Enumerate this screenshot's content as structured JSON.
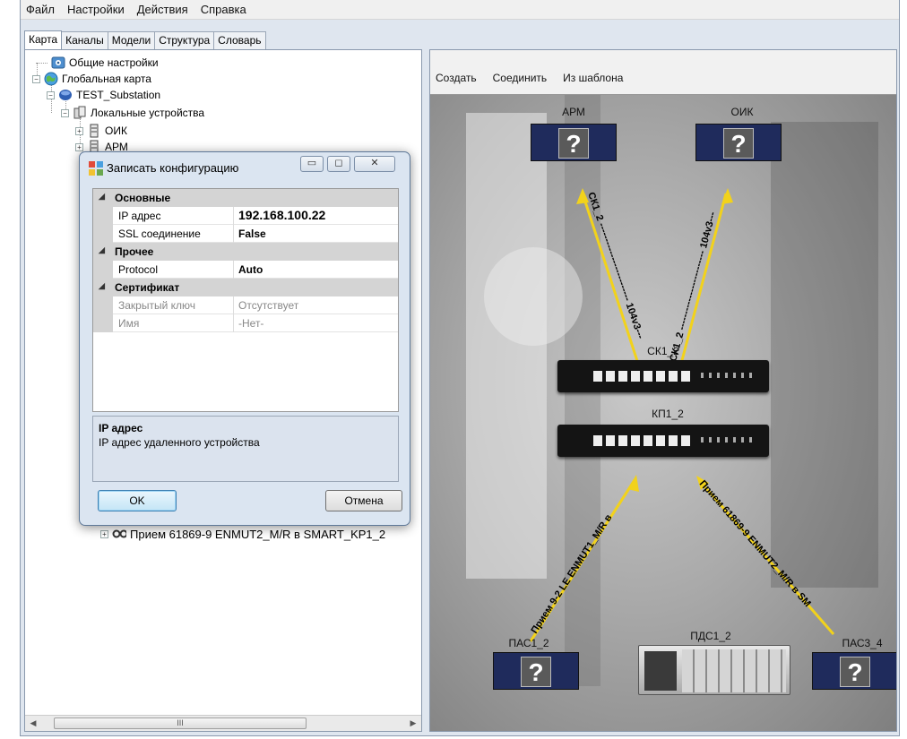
{
  "menu": [
    "Файл",
    "Настройки",
    "Действия",
    "Справка"
  ],
  "tabs": [
    "Карта",
    "Каналы",
    "Модели",
    "Структура",
    "Словарь"
  ],
  "tree": {
    "general": "Общие настройки",
    "global_map": "Глобальная карта",
    "substation": "TEST_Substation",
    "local_devices": "Локальные устройства",
    "oik": "ОИК",
    "arm": "АРМ",
    "bottom_item": "Прием 61869-9 ENMUT2_M/R в SMART_KP1_2"
  },
  "map_toolbar": {
    "create": "Создать",
    "connect": "Соединить",
    "from_template": "Из шаблона"
  },
  "map": {
    "nodes": {
      "arm": "АРМ",
      "oik": "ОИК",
      "sk1": "СК1_2",
      "kp1": "КП1_2",
      "pas1": "ПАС1_2",
      "pds1": "ПДС1_2",
      "pas3": "ПАС3_4"
    },
    "unknown_glyph": "?",
    "edges": {
      "e1": "СК1_2 ------------------------- 104v3---",
      "e2": "СК1_2 ------------------------- 104v3---",
      "e3": "Прием 9-2 LE ENMUT1_M/R в",
      "e4": "Прием 61869-9 ENMUT2_M/R в SM"
    },
    "edge_color": "#f2d21b"
  },
  "dialog": {
    "title": "Записать конфигурацию",
    "sections": [
      {
        "label": "Основные",
        "props": [
          {
            "name": "IP адрес",
            "value": "192.168.100.22"
          },
          {
            "name": "SSL соединение",
            "value": "False"
          }
        ]
      },
      {
        "label": "Прочее",
        "props": [
          {
            "name": "Protocol",
            "value": "Auto"
          }
        ]
      },
      {
        "label": "Сертификат",
        "props": [
          {
            "name": "Закрытый ключ",
            "value": "Отсутствует"
          },
          {
            "name": "Имя",
            "value": "-Нет-"
          }
        ]
      }
    ],
    "description_title": "IP адрес",
    "description_text": "IP адрес удаленного устройства",
    "ok": "OK",
    "cancel": "Отмена"
  },
  "scroll_grip": "III"
}
